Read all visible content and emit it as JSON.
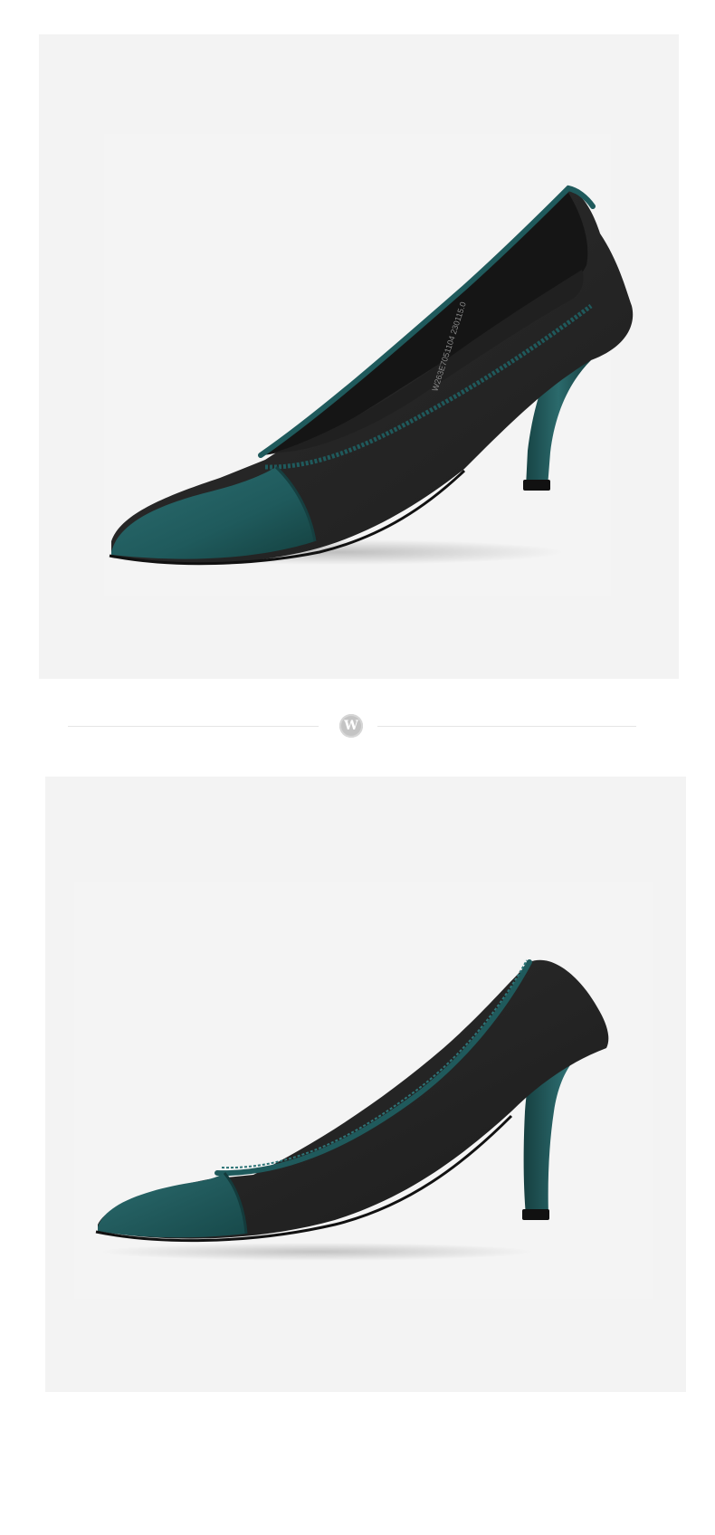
{
  "page": {
    "background": "#ffffff"
  },
  "photos": [
    {
      "subject": "pointed-toe pump, three-quarter view",
      "background": "#f3f3f3",
      "insole_print": "W263E7051104 230115.0"
    },
    {
      "subject": "pointed-toe pump, side profile",
      "background": "#f3f3f3"
    }
  ],
  "divider": {
    "badge_letter": "W",
    "badge_color": "#c4c4c4",
    "line_color": "#e5e5e5"
  },
  "colors": {
    "leather_teal": "#1f5a5c",
    "fabric_black": "#262626",
    "lining_black": "#1a1a1a"
  }
}
